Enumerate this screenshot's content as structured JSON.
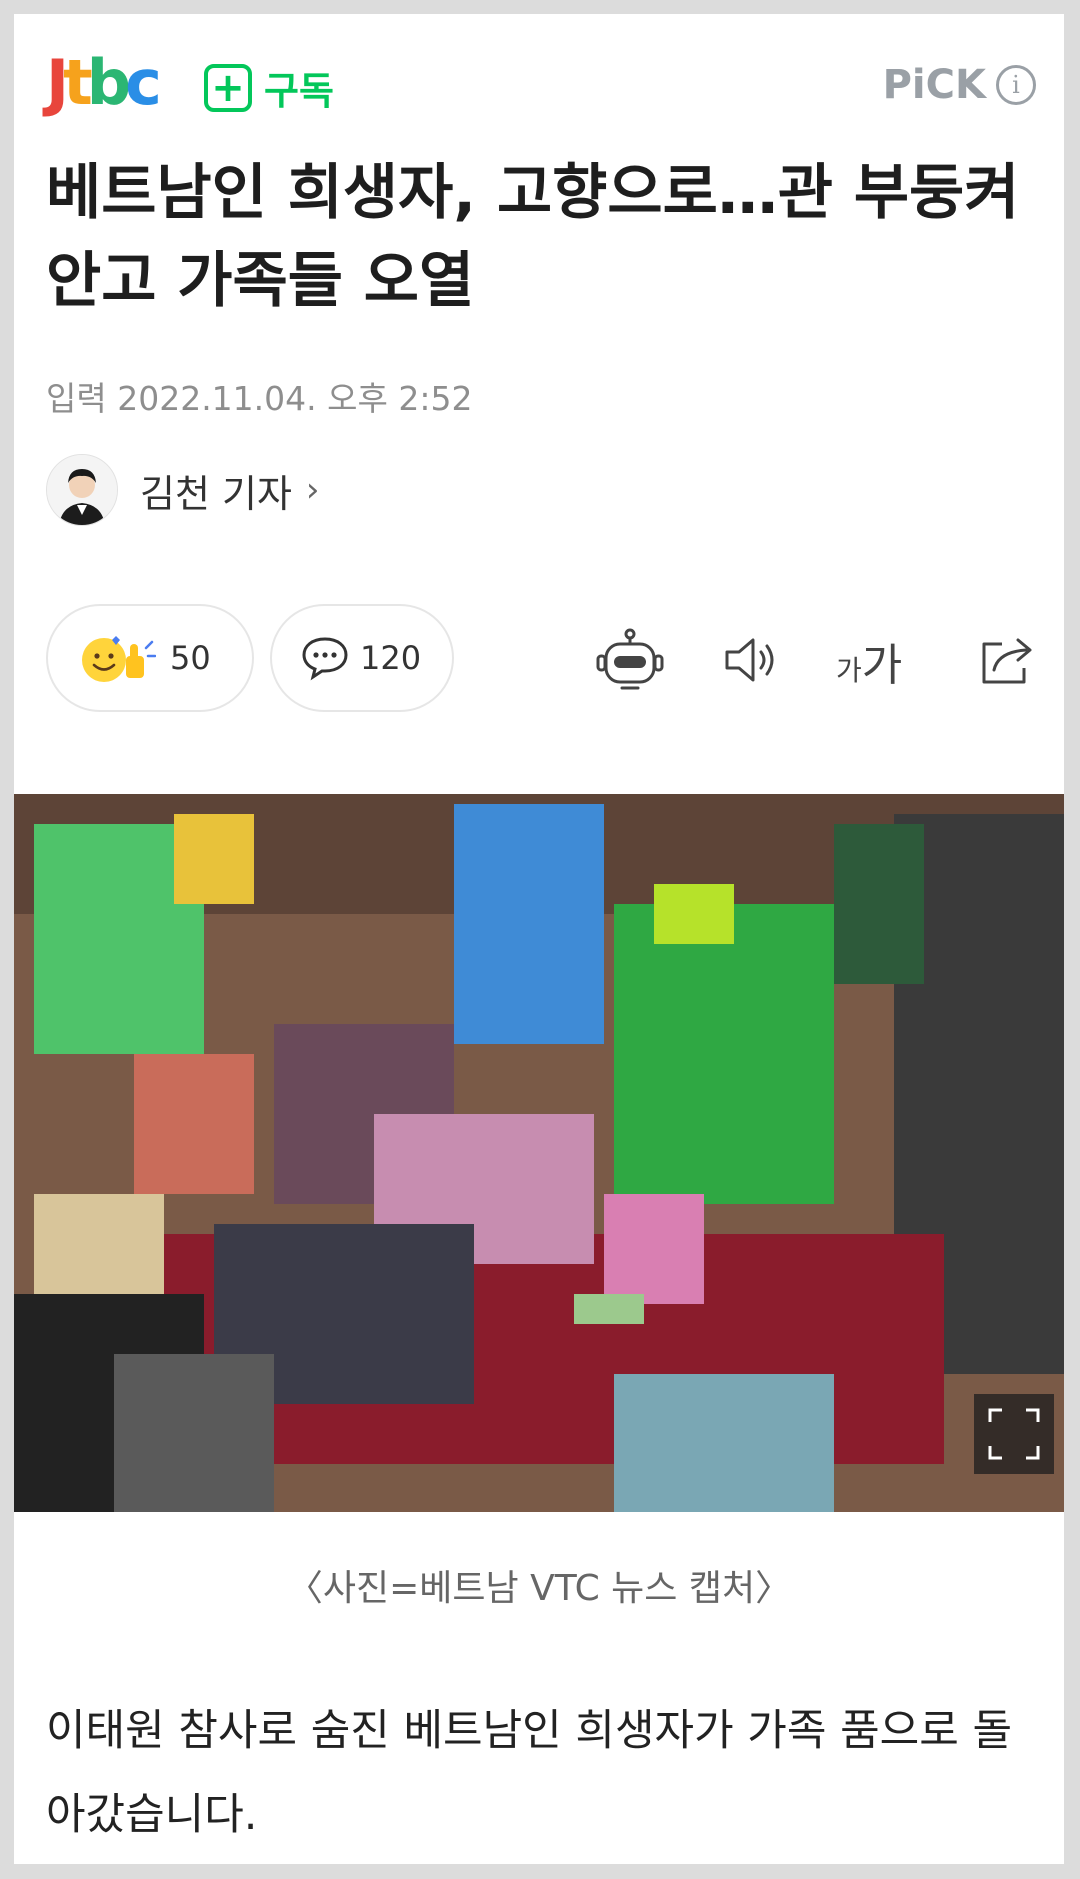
{
  "header": {
    "logo": {
      "j": "J",
      "t": "t",
      "b": "b",
      "c": "c"
    },
    "subscribe_label": "구독",
    "pick_label": "PiCK",
    "pick_info": "i"
  },
  "article": {
    "title": "베트남인 희생자, 고향으로…관 부둥켜안고 가족들 오열",
    "date": "입력 2022.11.04. 오후 2:52",
    "reporter": "김천 기자"
  },
  "actions": {
    "reaction_count": "50",
    "comment_count": "120",
    "font_small": "가",
    "font_large": "가"
  },
  "photo": {
    "caption": "〈사진=베트남 VTC 뉴스 캡처〉"
  },
  "body_text": "이태원 참사로 숨진 베트남인 희생자가 가족 품으로 돌아갔습니다.",
  "colors": {
    "subscribe": "#03c75a",
    "pick": "#9aa0a6",
    "logo_j": "#e8453c",
    "logo_t": "#f6a21c",
    "logo_b": "#2bb673",
    "logo_c": "#2a8ee6"
  }
}
